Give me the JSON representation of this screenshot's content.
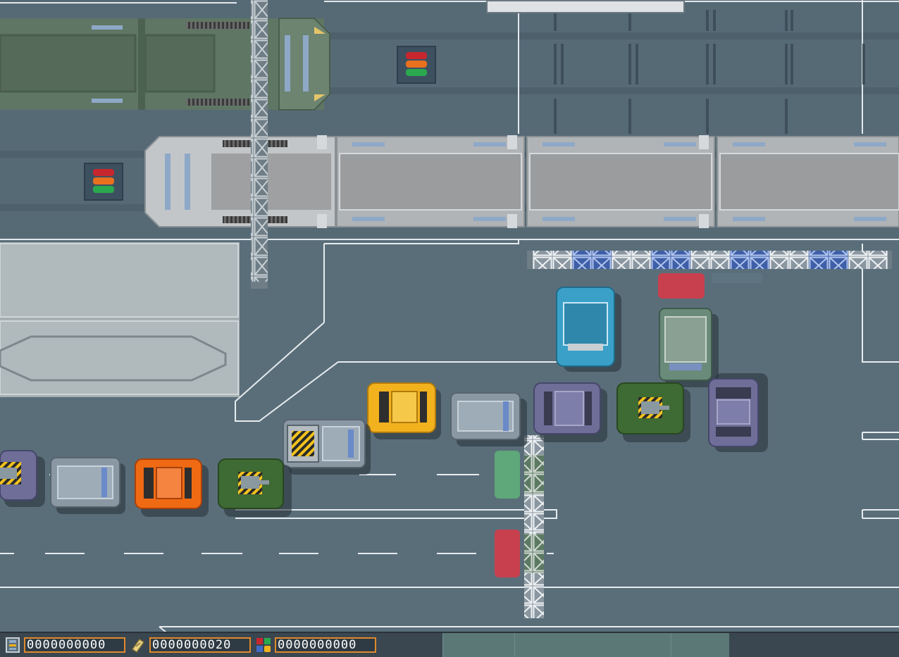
{
  "hud": {
    "cargo_counter": "0000000000",
    "ticket_counter": "0000000020",
    "blocks_counter": "0000000000",
    "icons": [
      "cargo-icon",
      "ticket-icon",
      "color-blocks-icon"
    ]
  },
  "scene": {
    "traffic_lights": [
      {
        "name": "traffic-light-upper",
        "state": "red-orange-green"
      },
      {
        "name": "traffic-light-lower",
        "state": "red-orange-green"
      }
    ],
    "vehicles": [
      {
        "name": "car-blue-parked",
        "color": "#3aa0c8"
      },
      {
        "name": "truck-green-parked",
        "color": "#6a8a7a"
      },
      {
        "name": "car-yellow",
        "color": "#f2b21e"
      },
      {
        "name": "car-grey-1",
        "color": "#8a98a4"
      },
      {
        "name": "car-purple-1",
        "color": "#6e6e98"
      },
      {
        "name": "tank-green-1",
        "color": "#3e6a34"
      },
      {
        "name": "car-purple-2",
        "color": "#6e6e98"
      },
      {
        "name": "car-grey-cargo",
        "color": "#8a98a4"
      },
      {
        "name": "tank-green-2",
        "color": "#3e6a34"
      },
      {
        "name": "car-orange",
        "color": "#f06a14"
      },
      {
        "name": "car-grey-2",
        "color": "#8a98a4"
      },
      {
        "name": "tank-purple",
        "color": "#6e6e98"
      }
    ]
  },
  "colors": {
    "road": "#5a6e7a",
    "road_line": "#dfe6ea",
    "counter_border": "#e08a2a"
  }
}
